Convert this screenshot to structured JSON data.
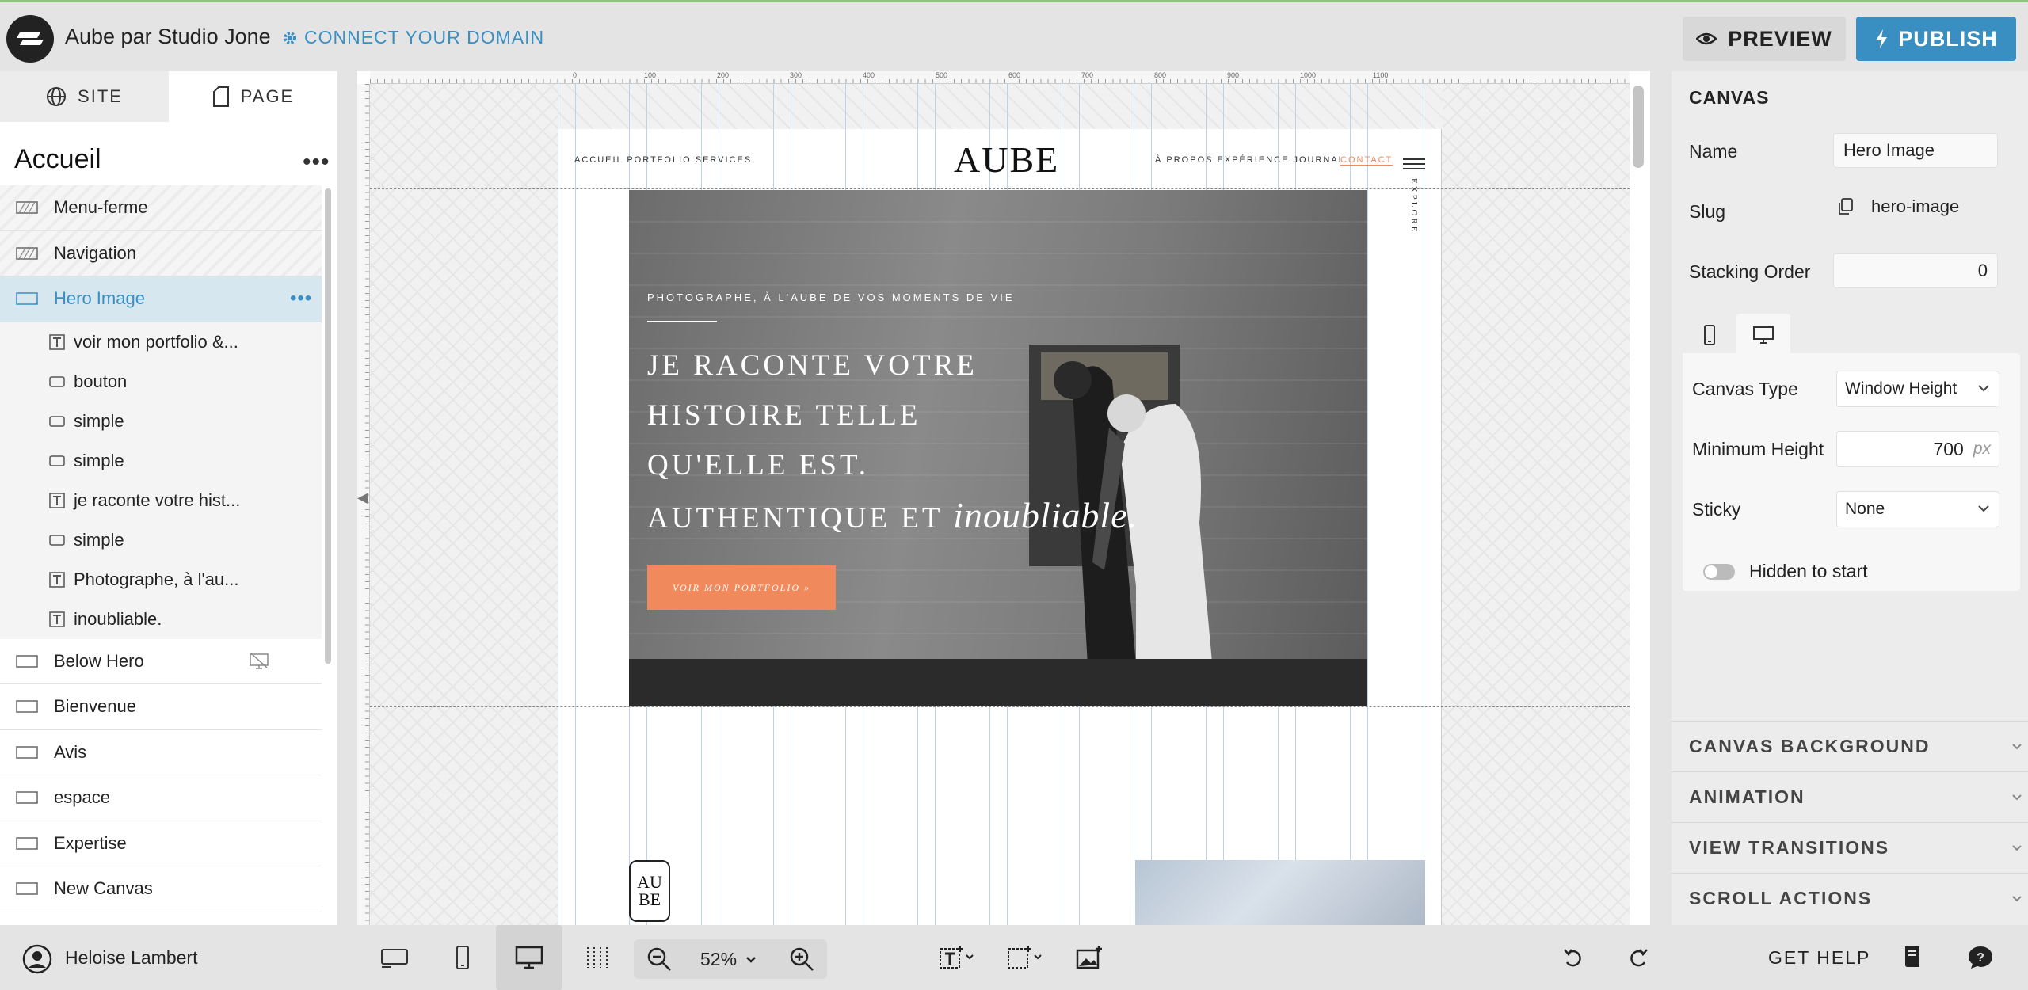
{
  "topbar": {
    "site_title": "Aube par Studio Jone",
    "connect_domain": "CONNECT YOUR DOMAIN",
    "preview": "PREVIEW",
    "publish": "PUBLISH"
  },
  "left_panel": {
    "tab_site": "SITE",
    "tab_page": "PAGE",
    "page_name": "Accueil",
    "more": "•••",
    "layers": [
      {
        "label": "Menu-ferme",
        "type": "hatched"
      },
      {
        "label": "Navigation",
        "type": "hatched"
      },
      {
        "label": "Hero Image",
        "type": "selected"
      },
      {
        "label": "voir mon portfolio &...",
        "type": "text"
      },
      {
        "label": "bouton",
        "type": "box"
      },
      {
        "label": "simple",
        "type": "box"
      },
      {
        "label": "simple",
        "type": "box"
      },
      {
        "label": "je raconte votre hist...",
        "type": "text"
      },
      {
        "label": "simple",
        "type": "box"
      },
      {
        "label": "Photographe, à l'au...",
        "type": "text"
      },
      {
        "label": "inoubliable.",
        "type": "text"
      },
      {
        "label": "Below Hero",
        "type": "canvas",
        "hidden": true
      },
      {
        "label": "Bienvenue",
        "type": "canvas"
      },
      {
        "label": "Avis",
        "type": "canvas"
      },
      {
        "label": "espace",
        "type": "canvas"
      },
      {
        "label": "Expertise",
        "type": "canvas"
      },
      {
        "label": "New Canvas",
        "type": "canvas"
      }
    ]
  },
  "canvas": {
    "ruler_marks": [
      "0",
      "100",
      "200",
      "300",
      "400",
      "500",
      "600",
      "700",
      "800",
      "900",
      "1000",
      "1100"
    ],
    "site": {
      "nav_left": "ACCUEIL  PORTFOLIO  SERVICES",
      "logo": "AUBE",
      "nav_right": "À PROPOS  EXPÉRIENCE  JOURNAL",
      "contact": "CONTACT",
      "explore": "EXPLORE",
      "hero_kicker": "PHOTOGRAPHE, À L'AUBE DE VOS MOMENTS DE VIE",
      "hero_line1": "JE RACONTE VOTRE",
      "hero_line2": "HISTOIRE TELLE",
      "hero_line3": "QU'ELLE EST.",
      "hero_line4": "AUTHENTIQUE ET",
      "hero_script": "inoubliable.",
      "hero_cta": "VOIR MON PORTFOLIO »",
      "badge_top": "AU",
      "badge_bottom": "BE"
    }
  },
  "right_panel": {
    "title": "CANVAS",
    "name_label": "Name",
    "name_value": "Hero Image",
    "slug_label": "Slug",
    "slug_value": "hero-image",
    "stacking_label": "Stacking Order",
    "stacking_value": "0",
    "canvas_type_label": "Canvas Type",
    "canvas_type_value": "Window Height",
    "min_height_label": "Minimum Height",
    "min_height_value": "700",
    "min_height_unit": "px",
    "sticky_label": "Sticky",
    "sticky_value": "None",
    "hidden_label": "Hidden to start",
    "sections": [
      "CANVAS BACKGROUND",
      "ANIMATION",
      "VIEW TRANSITIONS",
      "SCROLL ACTIONS"
    ]
  },
  "bottombar": {
    "user_name": "Heloise Lambert",
    "zoom": "52%",
    "get_help": "GET HELP"
  },
  "colors": {
    "accent": "#3a8fc2",
    "cta": "#f08a5d",
    "selected_layer_bg": "#d7e7f0"
  }
}
